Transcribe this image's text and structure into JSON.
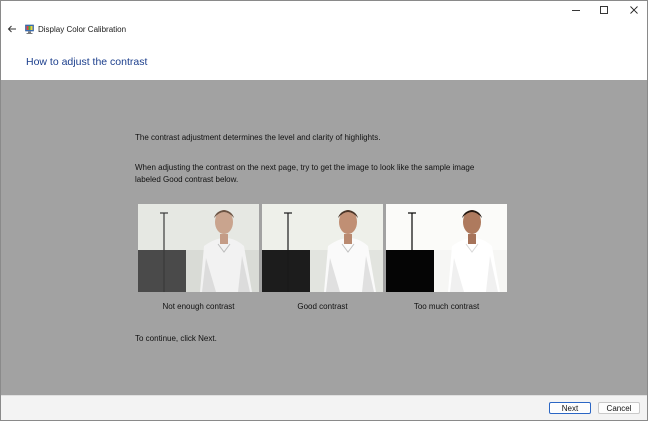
{
  "window": {
    "title": "Display Color Calibration",
    "controls": {
      "minimize_icon": "minimize-icon",
      "maximize_icon": "maximize-icon",
      "close_icon": "close-icon"
    },
    "back_icon": "back-arrow-icon",
    "app_icon": "display-calibration-icon"
  },
  "page": {
    "heading": "How to adjust the contrast",
    "paragraph_1": "The contrast adjustment determines the level and clarity of highlights.",
    "paragraph_2_line_1": "When adjusting the contrast on the next page, try to get the image to look like the sample image",
    "paragraph_2_line_2": "labeled Good contrast below.",
    "continue_text": "To continue, click Next."
  },
  "samples": [
    {
      "caption": "Not enough contrast",
      "variant": "low"
    },
    {
      "caption": "Good contrast",
      "variant": "good"
    },
    {
      "caption": "Too much contrast",
      "variant": "high"
    }
  ],
  "footer": {
    "next_label": "Next",
    "cancel_label": "Cancel"
  },
  "colors": {
    "heading": "#1b3e8c",
    "content_background": "#a2a2a2",
    "footer_background": "#f3f3f3",
    "default_button_border": "#2b66c4"
  }
}
